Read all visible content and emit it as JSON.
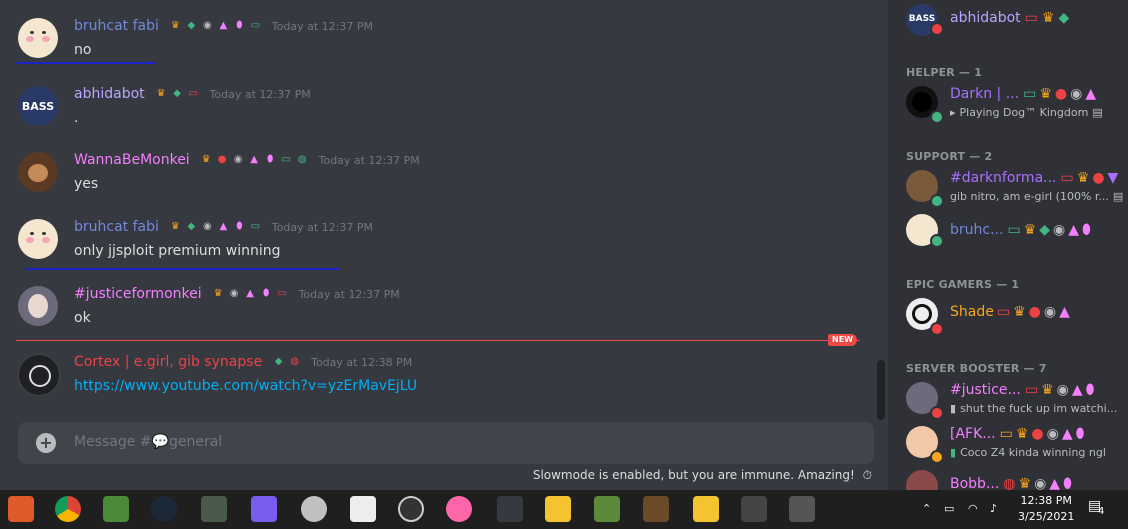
{
  "colors": {
    "accent": "#5865f2",
    "blurple_name": "#7289da",
    "pink_name": "#f47fff",
    "red_name": "#ed4245",
    "orange": "#faa61a",
    "green": "#43b581",
    "link": "#00aff4"
  },
  "messages": [
    {
      "author": "bruhcat fabi",
      "color": "#7289da",
      "timestamp": "Today at 12:37 PM",
      "text": "no"
    },
    {
      "author": "abhidabot",
      "color": "#b9a7ff",
      "timestamp": "Today at 12:37 PM",
      "text": "."
    },
    {
      "author": "WannaBeMonkei",
      "color": "#f47fff",
      "timestamp": "Today at 12:37 PM",
      "text": "yes"
    },
    {
      "author": "bruhcat fabi",
      "color": "#7289da",
      "timestamp": "Today at 12:37 PM",
      "text": "only jjsploit premium winning"
    },
    {
      "author": "#justiceformonkei",
      "color": "#f47fff",
      "timestamp": "Today at 12:37 PM",
      "text": "ok"
    },
    {
      "author": "Cortex | e.girl, gib synapse",
      "color": "#ed4245",
      "timestamp": "Today at 12:38 PM",
      "text": "https://www.youtube.com/watch?v=yzErMavEjLU"
    }
  ],
  "new_label": "NEW",
  "input": {
    "placeholder": "Message #💬general"
  },
  "slowmode_text": "Slowmode is enabled, but you are immune. Amazing!",
  "members": {
    "top": {
      "name": "abhidabot",
      "color": "#b9a7ff"
    },
    "categories": [
      {
        "title": "HELPER — 1",
        "members": [
          {
            "name": "Darkn | ...",
            "color": "#a970ff",
            "activity": "Playing Dog™ Kingdom",
            "status": "#43b581"
          }
        ]
      },
      {
        "title": "SUPPORT — 2",
        "members": [
          {
            "name": "#darknforma...",
            "color": "#a970ff",
            "activity": "gib nitro, am e-girl (100% r...",
            "status": "#43b581"
          },
          {
            "name": "bruhc...",
            "color": "#7289da",
            "activity": "",
            "status": "#43b581"
          }
        ]
      },
      {
        "title": "EPIC GAMERS — 1",
        "members": [
          {
            "name": "Shade",
            "color": "#faa61a",
            "activity": "",
            "status": "#ed4245"
          }
        ]
      },
      {
        "title": "SERVER BOOSTER — 7",
        "members": [
          {
            "name": "#justice...",
            "color": "#f47fff",
            "activity": "shut the fuck up im watchi...",
            "status": "#ed4245"
          },
          {
            "name": "[AFK...",
            "color": "#f47fff",
            "activity": "Coco Z4 kinda winning ngl",
            "status": "#faa61a"
          },
          {
            "name": "Bobb...",
            "color": "#f47fff",
            "activity": "",
            "status": "#43b581"
          }
        ]
      }
    ]
  },
  "taskbar": {
    "time": "12:38 PM",
    "date": "3/25/2021",
    "notifications": "4"
  }
}
